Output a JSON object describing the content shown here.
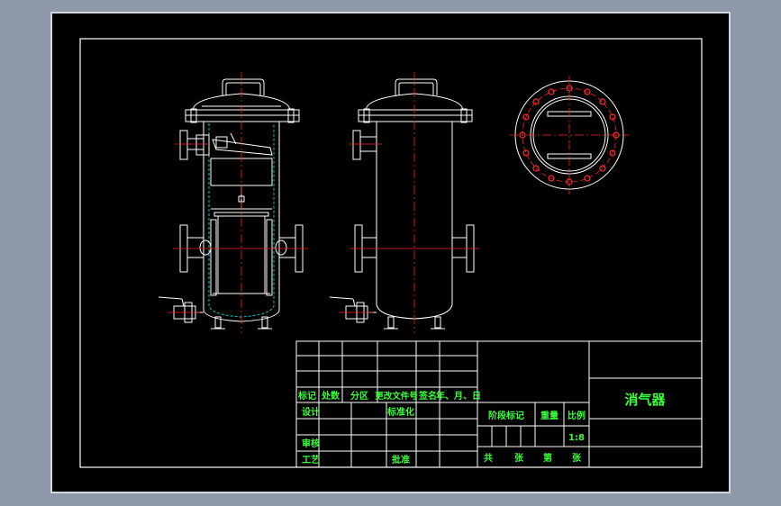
{
  "colors": {
    "background": "#8e98a8",
    "sheet": "#000000",
    "lines": "#ffffff",
    "centerlines": "#ff2020",
    "text": "#3cff3c",
    "filter": "#00c8d8"
  },
  "title_block": {
    "drawing_title": "消气器",
    "rev_headers": [
      "标记",
      "处数",
      "分区",
      "更改文件号",
      "签名",
      "年、月、日"
    ],
    "design": "设计",
    "standardize": "标准化",
    "review": "审核",
    "process": "工艺",
    "approve": "批准",
    "stage_mark": "阶段标记",
    "weight": "重量",
    "scale_label": "比例",
    "scale_value": "1:8",
    "total": "共",
    "sheets": "张",
    "sheet_no": "第",
    "sheet_unit": "张"
  }
}
